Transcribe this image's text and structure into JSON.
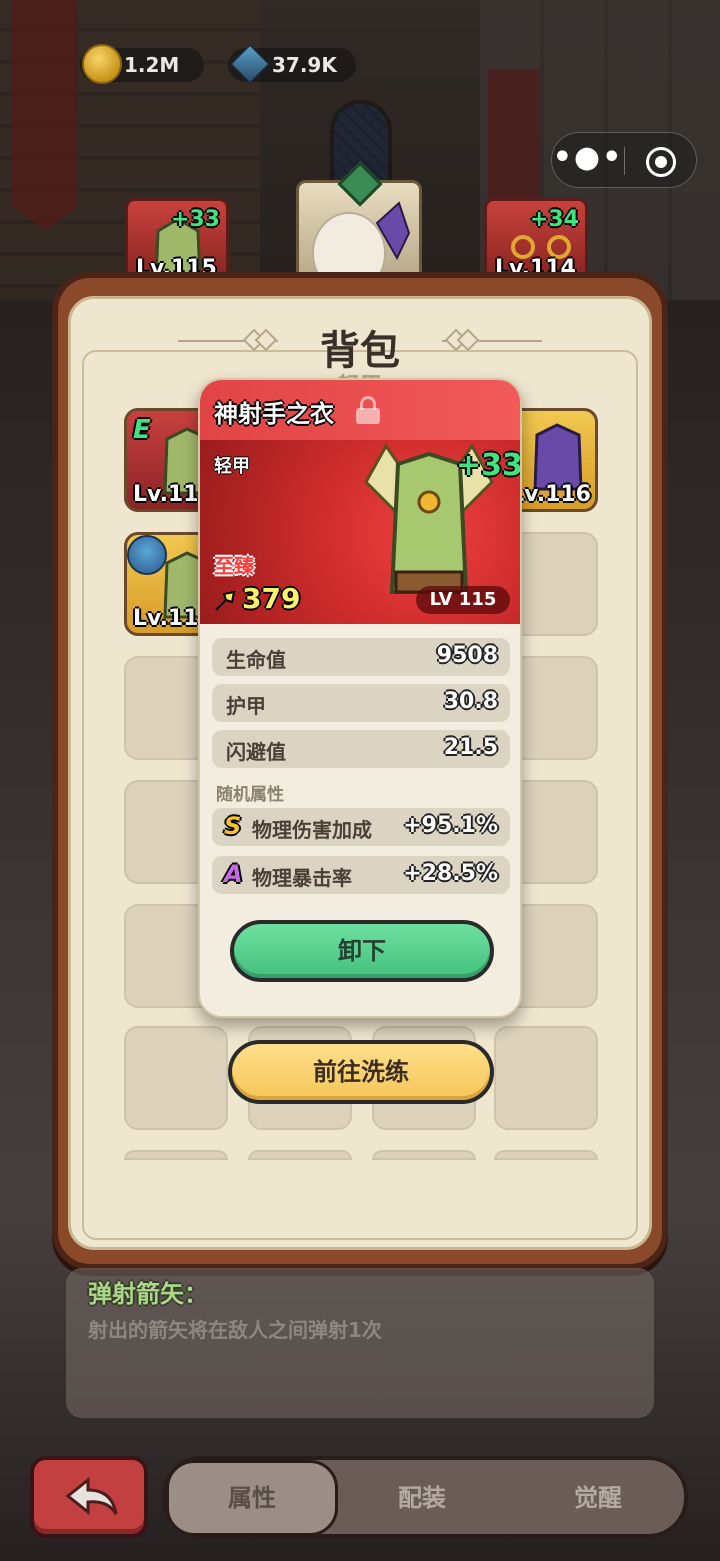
{
  "currency": {
    "gold": "1.2M",
    "gems": "37.9K"
  },
  "top_slots": {
    "armor": {
      "plus": "+33",
      "level": "Lv.115"
    },
    "ring": {
      "plus": "+34",
      "level": "Lv.114"
    }
  },
  "panel": {
    "title": "背包",
    "subtitle": "轻甲"
  },
  "grid": {
    "item1": {
      "grade": "E",
      "level": "Lv.115"
    },
    "item2": {
      "level": "Lv.116"
    },
    "item3": {
      "level": "Lv.115"
    }
  },
  "item": {
    "name": "神射手之衣",
    "type": "轻甲",
    "quality": "至臻",
    "power": "379",
    "plus": "+33",
    "level": "LV 115",
    "stats": [
      {
        "label": "生命值",
        "value": "9508"
      },
      {
        "label": "护甲",
        "value": "30.8"
      },
      {
        "label": "闪避值",
        "value": "21.5"
      }
    ],
    "random_title": "随机属性",
    "random_stats": [
      {
        "grade": "S",
        "label": "物理伤害加成",
        "value": "+95.1%",
        "grade_color": "#f2c230"
      },
      {
        "grade": "A",
        "label": "物理暴击率",
        "value": "+28.5%",
        "grade_color": "#c86ae8"
      }
    ],
    "unequip_label": "卸下"
  },
  "refine_label": "前往洗练",
  "skill": {
    "name": "弹射箭矢：",
    "description": "射出的箭矢将在敌人之间弹射1次"
  },
  "tabs": {
    "attributes": "属性",
    "equip": "配装",
    "awaken": "觉醒"
  },
  "capsule": {
    "more": "•●•"
  },
  "colors": {
    "accent_green": "#41e37c",
    "header_red": "#e14444",
    "unequip_green": "#4fcf88",
    "refine_yellow": "#f8d06a"
  }
}
